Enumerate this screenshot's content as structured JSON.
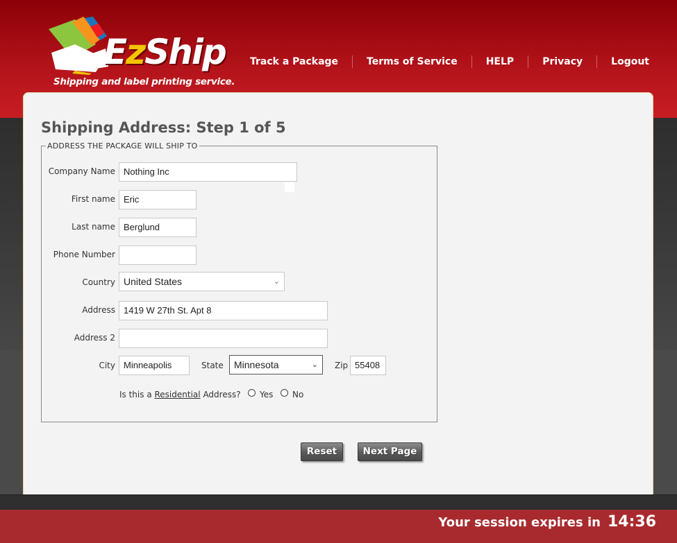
{
  "brand": {
    "name_part1": "E",
    "name_part2": "z",
    "name_part3": "Ship",
    "tagline": "Shipping and label printing service."
  },
  "nav": {
    "items": [
      {
        "label": "Track a Package"
      },
      {
        "label": "Terms of Service"
      },
      {
        "label": "HELP"
      },
      {
        "label": "Privacy"
      },
      {
        "label": "Logout"
      }
    ]
  },
  "page": {
    "title": "Shipping Address: Step 1 of 5",
    "fieldset_legend": "ADDRESS THE PACKAGE WILL SHIP TO"
  },
  "form": {
    "company_label": "Company Name",
    "company_value": "Nothing Inc",
    "first_label": "First name",
    "first_value": "Eric",
    "last_label": "Last name",
    "last_value": "Berglund",
    "phone_label": "Phone Number",
    "phone_value": "",
    "country_label": "Country",
    "country_value": "United States",
    "address_label": "Address",
    "address_value": "1419 W 27th St. Apt 8",
    "address2_label": "Address 2",
    "address2_value": "",
    "city_label": "City",
    "city_value": "Minneapolis",
    "state_label": "State",
    "state_value": "Minnesota",
    "zip_label": "Zip",
    "zip_value": "55408",
    "residential_prefix": "Is this a",
    "residential_link": "Residential",
    "residential_suffix": "Address?",
    "yes_label": "Yes",
    "no_label": "No",
    "residential_selected": "none"
  },
  "buttons": {
    "reset": "Reset",
    "next": "Next Page"
  },
  "session": {
    "label": "Your session expires in",
    "time": "14:36"
  },
  "colors": {
    "header_red": "#b5141b",
    "footer_red": "#a82a2e",
    "logo_yellow": "#f2c500"
  }
}
